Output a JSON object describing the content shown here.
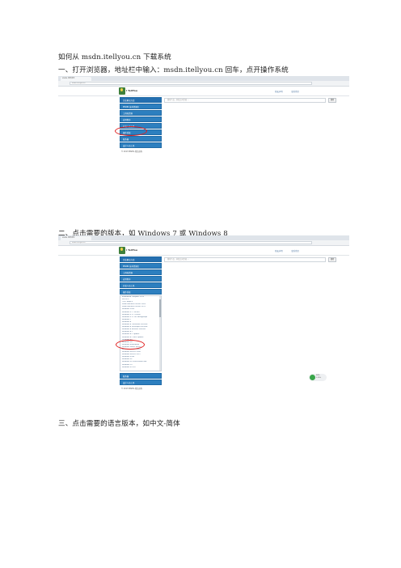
{
  "text": {
    "intro": "如何从 msdn.itellyou.cn 下载系统",
    "step1": "一、打开浏览器，地址栏中输入：msdn.itellyou.cn 回车，点开操作系统",
    "step2": "二、点击需要的版本，如 Windows 7 或 Windows 8",
    "step3": "三、点击需要的语言版本，如中文-简体"
  },
  "screenshot1": {
    "tab_title": "MSDN, 我告诉你",
    "address": "msdn.itellyou.cn",
    "logo_text": "I TellYou",
    "header_links": [
      "隐私声明",
      "联系我们"
    ],
    "search_placeholder": "搜索产品，多组之间空格 ...",
    "search_button": "搜索",
    "menu": [
      "企业解决方案",
      "MSDN 技术资源库",
      "工具和资源",
      "应用程序",
      "开发人员工具",
      "操作系统",
      "服务器",
      "设计人员工具"
    ],
    "footer": "© 2013 MSDN, 我告诉你"
  },
  "screenshot2": {
    "tab_title": "MSDN, 我告诉你",
    "address": "msdn.itellyou.cn",
    "logo_text": "I TellYou",
    "header_links": [
      "隐私声明",
      "联系我们"
    ],
    "search_placeholder": "搜索产品，多组之间空格 ...",
    "search_button": "搜索",
    "menu_top": [
      "企业解决方案",
      "MSDN 技术资源库",
      "工具和资源",
      "应用程序",
      "开发人员工具",
      "操作系统"
    ],
    "os_list": [
      "Embedded Compact 2013",
      "MS-DOS",
      "OS/2 Warp 4",
      "Small Business Server 2003",
      "Small Business Server 2011",
      "Windows 2000",
      "Windows 3.1 (16-bit)",
      "Windows 3.11 (16-bit)",
      "Windows 3.11 for Workgroups",
      "Windows 7",
      "Windows 8",
      "Windows 8 Consumer Preview",
      "Windows 8 Developer Preview",
      "Windows 8 Release Preview",
      "Windows 8.1",
      "Windows 8.1 Update",
      "Windows 8.1 with Update",
      "Windows 95",
      "Windows 98",
      "Windows Embedded",
      "Windows Home Server",
      "Windows Server 2003",
      "Windows Server 2008",
      "Windows Server 2012",
      "Windows Vista",
      "Windows XP",
      "Windows XP Professional x64",
      "Windows 10",
      "Windows NT 4.0"
    ],
    "menu_bottom": [
      "服务器",
      "设计人员工具"
    ],
    "footer": "© 2013 MSDN, 我告诉你",
    "widget": [
      "58%",
      "0.1K/s"
    ]
  },
  "colors": {
    "menu_blue": "#2d7fbf",
    "highlight_red": "#e02020"
  }
}
